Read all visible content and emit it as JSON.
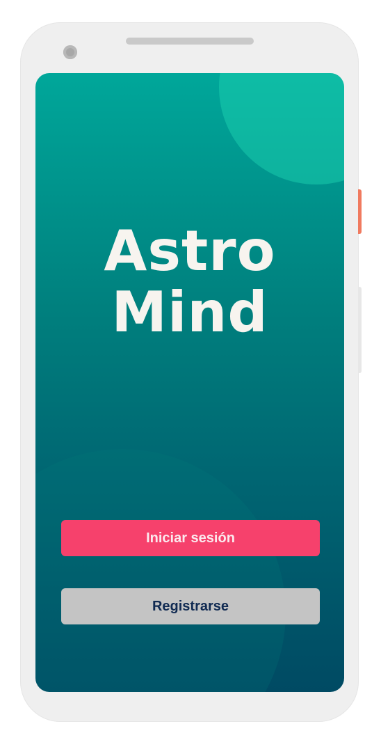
{
  "app": {
    "title_line1": "Astro",
    "title_line2": "Mind"
  },
  "actions": {
    "login_label": "Iniciar sesión",
    "register_label": "Registrarse"
  },
  "colors": {
    "login_button": "#f6416c",
    "register_button": "#c4c4c4",
    "background_top": "#00a79a",
    "background_bottom": "#004a63"
  }
}
